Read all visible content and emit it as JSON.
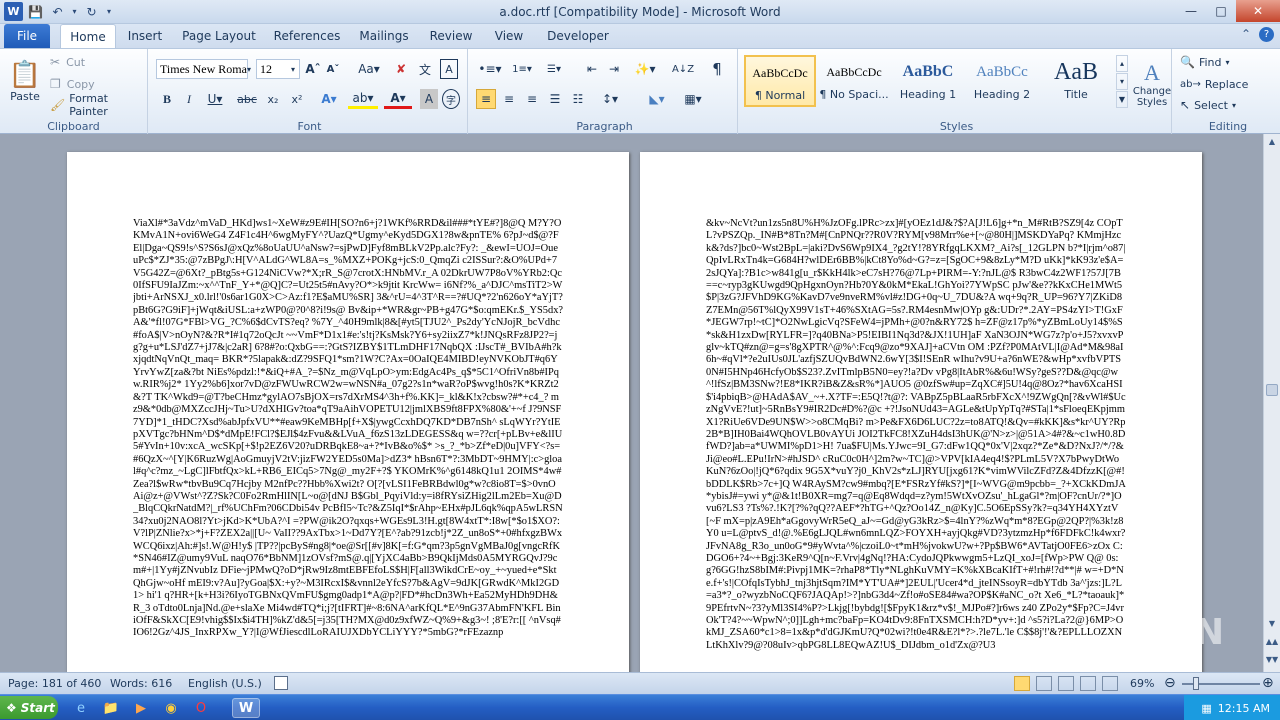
{
  "window": {
    "title": "a.doc.rtf [Compatibility Mode] - Microsoft Word"
  },
  "tabs": [
    "File",
    "Home",
    "Insert",
    "Page Layout",
    "References",
    "Mailings",
    "Review",
    "View",
    "Developer"
  ],
  "clipboard": {
    "paste": "Paste",
    "cut": "Cut",
    "copy": "Copy",
    "format_painter": "Format Painter",
    "label": "Clipboard"
  },
  "font": {
    "name": "Times New Roma",
    "size": "12",
    "label": "Font"
  },
  "paragraph": {
    "label": "Paragraph"
  },
  "styles": {
    "items": [
      {
        "preview": "AaBbCcDc",
        "name": "¶ Normal"
      },
      {
        "preview": "AaBbCcDc",
        "name": "¶ No Spaci..."
      },
      {
        "preview": "AaBbC",
        "name": "Heading 1"
      },
      {
        "preview": "AaBbCc",
        "name": "Heading 2"
      },
      {
        "preview": "AaB",
        "name": "Title"
      }
    ],
    "change_styles": "Change Styles",
    "label": "Styles"
  },
  "editing": {
    "find": "Find",
    "replace": "Replace",
    "select": "Select",
    "label": "Editing"
  },
  "document": {
    "page_left": "ViaXl#*3aVdz^mVaD_HKd]ws1~XeW#z9E#IH[SO?n6+j?1WKf%RRD&il###*tYE#?]8@Q M?Y?OKMvA1N+ovi6WeG4 Z4F1c4H^6wgMyFY^?UazQ*Ugmy^eKyd5DGX1?8w&pnTE% 6?pJ~d$@?FEl|Dga~QS9!s^S?S6sJ@xQz%8oUaUU^aNsw?=sjPwD]Fyf8mBLkV2Pp.alc?Fy?: _&ewI=UOJ=OueuPc$*ZJ*35:@7zBPgJ\\:H[V^ALdG^WL8A=s_%MXZ+POKg+jcS:0_QmqZi c2ISSur?:&O%UPd+7V5G42Z=@6Xt?_pBtg5s+G124NiCVw?*X;rR_S@7crotX:HNbMV.r_A 02DkrUW7P8oV%YRb2:Qc0IfSFU9IaJZm:~x^^TnF_Y+*@Q]C?=Ut25t5#nAvy?O*>k9jtit KrcWw= i6Nf?%_a^DJC^msTiT2>Wjbti+ArNSXJ_x0.lrl!'0s6ar1G0X>C>Az:f1?E$aMU%SR] 3&^rU=4^3T^R==?#UQ*?2'n626oY*aYjT?pBt6G?G9iF]+jWqt&iUSL:a+zWP0@?0^8?i!9s@ Bv&ip+*WR&gr~PB+g47G*$o:qmEKr.$_YS5dx?A&'*fl!07G*FBl>VG_?C%6$dCvTS?eq? %7Y_^40H9mlk|8&[#yt5[TJU2^_Ps2dy'YcNJojR_bcVdhc#foA$|V>nOyN?&?R*I#1q72oQcJt ~~VmF*D1x1#e:'s!tj?KsMsk?Y6+sy2iixZ7*k!JNQsRFz8JP2?=jg?g+u*LSJ'dZ7+jJ7&|c2aR] 6?8#?o:QxbG==:?GtS?IZBY$1TLmDHF17NqbQX :IJscT#_BVIbA#h?kxjqdtNqVnQt_maq= BKR*?5lapak&:dZ?9SFQ1*sm?1W?C?Ax=0OaIQE4MIBD!eyNVKObJT#q6YYrvYwZ[za&?bt NiEs%pdzl:!*&iQ+#A_?=$Nz_m@VqLpO>ym:EdgAc4Ps_q$*5C1^OfriVn8b#IPqw.RIR%j2* 1Yy2%b6]xor7vD@zFWUwRCW2w=wNSN#a_07g2?s1n*waR?oP$wvg!h0s?K*KRZt2&?T TK^Wkd9=@T?beCHmz*gylAO7sBjOX=rs7dXrMS4^3h+f%.KK]=_kl&K!x?cbsw?#*+c4_? mz9&*0db@MXZccJHj~Tu>U?dXHIGv?toa*qT9aAihVOPETU12|jmlXBS9ft8FPX%80&'+~f J?9NSF7YD]*1_tHDC?Xsd%abJpfxVU**#eaw9KeMBHp[f+X$|ywgCcxhDQ7KD*DB7nSh^ sLqWYr?YtIEpXVTgc?bHNm^D$*dMpE!FCl?$EJl$4zFvu&&LVuA_f6zS13zLDEGESS&q w=??cr[+pLBv+e&lIU5#YvIn+10v:xcA_wcSKp[+$!p2EZ6V20?uDRBqkE8~a+?*IvB&o%$* >s_?_*b>Zf*eD|0u]VFY<?s=#6QzX~^[Y|K6RuzWg|AoGmuyjV2tV:jizFW2YED5s0Ma]>dZ3* hBsn6T*?:3MbDT~9HMY|:c>gloal#q^c?mz_~LgC]lFbtfQx>kL+RB6_EICq5>7Ng@_my2F+?$ YKOMrK%^g6148kQ1u1 2OIMS*4w#Zea?l$wRw*tbvBu9Cq7Hcjby M2nfPc??Hbb%Xwi2t? O[?[vLSI1FeBRBdwl0g*w?c8io8T=$>0vnOAi@z+@VWst^?Z?Sk?C0Fo2RmHlIN[L~o@[dNJ B$Gbl_PqyiVld:y=i8fRYsiZHig2lLm2Eb=Xu@D_BlqCQkrNatdM?|_rf%UChFm?06CDbi54v PcBfI5~Tc?&Z5IqI*$rAhp~EHx#pJL6qk%qpA5wLRSN34?xu0j2NAO8l?Yt>jKd>K*UbA?^I =?PW@ik2O?qxqs+WGEs9L3!H.gt[8W4xtT*:I8w[*$o1$XO?:V?lP|ZNlie?x>*j+F?ZEX2a||[U~ VaII??9AxTbx>1~Dd7Y?[E^?ab?91zcb!j*2Z_un8oS*+0#hfxgzBWxWCQ6ixz|Ah:#]s!.W@H!y$ |TP??|pcByS#ng8|*oe@Sr[[#v]8K[=f:G*qm?3p5gnVgMBaJ0g[vngcRfK*SN46#IZ@umy9VuL naqO76*BbNM]1zOVsf?mS@.q|[YjXC4aBb>B9QkIjMds0A5MYRGQvJ?9cm#+|1Yy#jZNvubIz DFie~jPMwQ?oD*jRw9Iz8mtEBFEfoLS$H|F[all3WikdCrE~oy_+~yued+e*SktQhGjw~oHf mEI9:v?Au]?yGoa|$X:+y?~M3IRcxI$&vnnl2eYfcS?7b&AgV=9dJK[GRwdK^MkI2GD1> hi'1 q?HR+[k+H3i?6IyoTGBNxQVmFU$gmg0adp1*A@p?|FD*#hcDn3Wh+Ea52MyHDh9DH&R_3 oTdto0Lnja]Nd.@e+slaXe Mi4wd#TQ*i;j?[tIFRT]#~8:6NA^arKfQL*E^9nG37AbmFN'KFL BiniOfF&SkXC[E9!vhig$$Ix$i4TH]%kZ'd&5[=j35[TH?MX@d0z9xfWZ~Q%9+&g3~! ;8'E?r:[[ ^nVsq#IO6!2Gz^4JS_InxRPXw_Y?|I@WfJiescdlLoRAIUJXDbYCLiYYY?*5mbG?*rFEzaznp",
    "page_right": "&kv~NcVt?un1zs5n8U%H%JzOFg.lPRc>zx]#[yOEz1dJ&?$?A[J!L6]g+*n_M#RtB?SZ9[4z COpTL?vPSZQp._IN#B*8Tn?M#[CnPNQr??R0V?RYM[v98Mrr%e+[~@80H|]MSKDYaPq? KMmjHzck&?ds?]bc0~Wst2BpL=|aki?DvS6Wp9IX4_?g2tY!?8YRfgqLKXM?_Ai?s[_12GLPN b?*I|rjm^o87|QpIvLRxTn4k=G684H?wlDEr6BB%|kCt8Yo%d~G?=z=[SgOC+9&8zLy*M?D uKk]*kK93z'e$A=2sJQYa]:?B1c>w841g[u_r$KkH4lk>eC7sH?76@7Lp+PIRM=-Y:?nJL@$ R3bwC4z2WF1?57J[7B==c~ryp3gKUwgd9QpHgxnOyn?Hb?0Y&0kM*EkaL!GhYoi?7YWpSC pJw'&e??kKxCHe1MWt5$P|3zG?JFVhD9KG%KavD7ve9nveRM%vl#z!DG+0q~U_7DU&?A wq+9q?R_UP=96?Y7|ZKiD8Z7EMn@56T%lQyX99V1sT+46%SXtAG=5s?.RM4esnMw|OYp g&:UDr?*.2AY=PS4zYI>T!GxF*JEGW7rp!~tC]*O2NwLgicVq?SFeW4=jPMh+@0?n&RY72$ h=ZF@z17p%*yZBmLoUy14$%S*sk&H1zxDw[RYLFR=]?q40BNa>P5!EIBI1Nq3d?&JX!1UH]aF XaN3OJN*WG7z?p'o+J5?xvxvPglv~kTQ#zn@=g=s'8gXPTR^@%^:Fcq9@zo*9XAJ]+aCVtn OM :PZf?P0MAtVL|I@Ad*M&98aI6h~#qVl*?e2uIUs0JL'azfjSZUQvBdWN2.6wY[3$I!SEnR wIhu?v9U+a?6nWE?&wHp*xvfbVPTS0N#I5HNp46HcfyOb$S23?.ZvITmlpB5N0=ey?!a?Dv vPg8|ItAbR%&6u!WSy?geS??D&@qc@w^!lfSz|BM3SNw?!E8*IKR?iB&Z&sR%*]AUO5 @0zfSw#up=ZqXC#]5U!4q@8Oz?*hav6XcaHSI$'i4pbiqB>@HAdA$AV_~+.X?TF=:E5Q!?t@?: VABpZ5pBLaaR5rbFXcX^!9ZWgQn[?&vWl#$UczNgVvE?!ut]~5RnBsY9#IR2Dc#D%?@c +?!JsoNUd43=AGLe&tUpYpTq?#STa|1*sFloeqEKpjmmX1?RiUe6VDe9UN$W>>o8CMqBi? m>Pe&FX6D6LUC?2z=to8ATQ!&Qv=#kKK]&s*kr^UY?Rp2B*B]IH0Bai4WQhOVLB0vAYUi JOI2TkFC8!XZuH4dsI3hUK@'N>z>|@51A>4#?&~c1wH0.8DfWD?]ab=a*UWMI%pD1>H! 7ua$FU|Ms.YJwc=9I_G7:dFw1QQ*0x'V|2xqz?*Ze*&D?NxJ?/*/?&Ji@eo#L.EPu!IrN>#hJSD^ cRuC0c0H^]2m?w~TC]@>VPV[kIA4eq4!$?PLmL5V?X7bPwyDtWoKuN?6zOo|!jQ*6?qdix 9G5X*vuY?j0_KhV2s*zLJ]RYU[jxg61?K*vimWVilcZFd?Z&4DfzzK[@#!bDDLK$Rb>7c+]Q W4RAySM?cw9#mbq?[E*FSRzYf#kS?]*[I~WVG@m9pcbb=_?+XCkKDmJA*ybisJ#=ywi y*@&1t!B0XR=mg7=q@Eq8Wdqd=z?ym!5WtXvOZsu'_hLgaGl*?m|OF?cnUr/?*]Ovu6?LS3 ?Ts%?.!K?[?%?qQ??AEF*?hTG+^Qz?Oo14Z_n@Ky]C.5O6EpSSy?k?=q34YH4XYztV[~F mX=p|zA9Eh*aGgovyWrR5eQ_aJ~=Gd@yG3kRz>$=4lnY?%zWq*m*8?EGp@2QP?|%3k!z8Y0 u=L@ptvS_d!@.%E6gLJQL#wn6mnLQZ>FOYXH+ayjQkg#VD?3ytzmzHp*f6FDFkC!k4wxr? JFvNA8g_R3o_un0oG*9#yWvta^%|czoiL0~t*mH%jvokwU?w+?Pp$BW6*AVTatjO0FE6>zOx C:DGO6+?4~+Bgj:3KeR9^Q[n~F.Vrv|4gNq!?HA:CydoJQPkwwgm5+LzQI_xoJ=[fWp>PW Q@ 0s:g?6GG!hzS8bIM#:Pivpj1MK=?rhaP8*Tly*NLghKuVMY=K%kXBcaKIfT+#!rh#!?d**|# w=+D*Ne.f+'s!|COfqIsTybhJ_tnj3hjtSqm?IM*YT'UA#*]2EUL|'Ucer4*d_jteINSsoyR=dbYTdb 3a^'jzs:]L?L=a3*?_o?wyzbNoCQF6?JAQAp!>?]nbG3d4~Zf!o#oSE84#wa?OP$K#aNC_o?t Xe6_*L?*taoauk]*9PEfrtvN~?3?yMl3SI4%P?>Lkjg[!bybdg![$FpyK1&rz*v$!_MJPo#?]r6ws z40 ZPo2y*$Fp?C=J4vrOk'T?4?~~WpwN^;0]]Lgh+mc?baFp=KO4tDv9:8FnTXSMCH:h?D*yv+:]d ^s5?i?La?2@}6MP>OkMJ_ZSA60*c1>8=1x&p*d'dGJKmU?Q*02wi?!t0e4R&E?l*?>.?le7L.'le C$$8j'!'&?EPLLLOZXNLtKhXlv?9@?08uIv>qbPG8LL8EQwAZ!U$_DIJdbm_o1d'Zx@?U3"
  },
  "status": {
    "page": "Page: 181 of 460",
    "words": "Words: 616",
    "language": "English (U.S.)",
    "zoom": "69%"
  },
  "taskbar": {
    "start": "Start",
    "time": "12:15 AM"
  },
  "watermark": "RUN"
}
